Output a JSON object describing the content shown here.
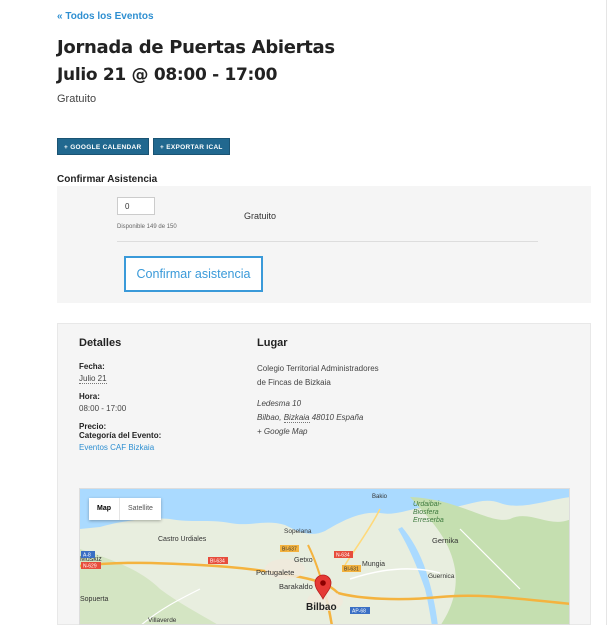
{
  "nav": {
    "back_link": "« Todos los Eventos"
  },
  "event": {
    "title": "Jornada de Puertas Abiertas",
    "datetime": "Julio 21 @ 08:00 - 17:00",
    "cost": "Gratuito"
  },
  "actions": {
    "google_calendar": "+ GOOGLE CALENDAR",
    "export_ical": "+ EXPORTAR ICAL"
  },
  "rsvp": {
    "heading": "Confirmar Asistencia",
    "quantity": "0",
    "available": "Disponible 149 de 150",
    "price": "Gratuito",
    "confirm_button": "Confirmar asistencia"
  },
  "details": {
    "heading": "Detalles",
    "fecha_label": "Fecha:",
    "fecha_value": "Julio 21",
    "hora_label": "Hora:",
    "hora_value": "08:00 - 17:00",
    "precio_label": "Precio:",
    "categoria_label": "Categoría del Evento:",
    "categoria_value": "Eventos CAF Bizkaia"
  },
  "venue": {
    "heading": "Lugar",
    "name_line1": "Colegio Territorial Administradores",
    "name_line2": "de Fincas de Bizkaia",
    "street": "Ledesma 10",
    "city": "Bilbao,",
    "region": "Bizkaia",
    "postal_country": "48010 España",
    "map_link": "+ Google Map"
  },
  "map": {
    "tab_map": "Map",
    "tab_satellite": "Satellite",
    "labels": {
      "bakio": "Bakio",
      "urdaibai": "Urdaibai-",
      "biosfera": "Biosfera",
      "erreserba": "Erreserba",
      "castro": "Castro Urdiales",
      "sopelana": "Sopelana",
      "getxo": "Getxo",
      "portugalete": "Portugalete",
      "mungia": "Mungia",
      "gernika": "Gernika",
      "muskiz": "Muskiz",
      "barakaldo": "Barakaldo",
      "bilbao": "Bilbao",
      "guernica": "Guernica",
      "sopuerta": "Sopuerta",
      "villaverde": "Villaverde",
      "bi637": "BI-637",
      "bi631": "BI-631",
      "bi634": "BI-634",
      "n634a": "N-634",
      "n634b": "N-634",
      "a8": "A-8",
      "n629": "N-629",
      "ap68": "AP-68"
    }
  },
  "colors": {
    "accent": "#2e8fd1",
    "button_dark": "#21688f",
    "panel_bg": "#f5f5f5",
    "map_water": "#aadaff",
    "map_land": "#e8eedf",
    "map_forest": "#c5dfb0",
    "map_highway": "#f4b33f",
    "map_pin": "#e53935"
  }
}
